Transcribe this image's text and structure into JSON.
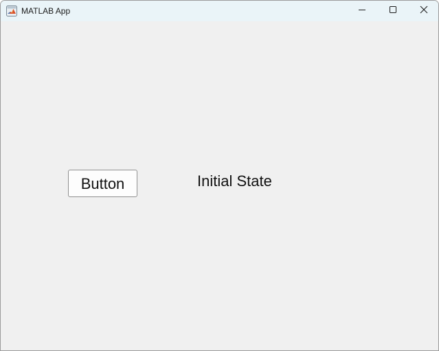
{
  "window": {
    "title": "MATLAB App",
    "app_icon": "matlab-logo-icon",
    "controls": {
      "minimize_icon": "minimize-icon",
      "maximize_icon": "maximize-icon",
      "close_icon": "close-icon"
    }
  },
  "main": {
    "button_label": "Button",
    "status_label": "Initial State"
  },
  "colors": {
    "titlebar": "#eaf4f8",
    "background": "#f0f0f0",
    "button_border": "#8f8f8f",
    "text": "#111111"
  }
}
